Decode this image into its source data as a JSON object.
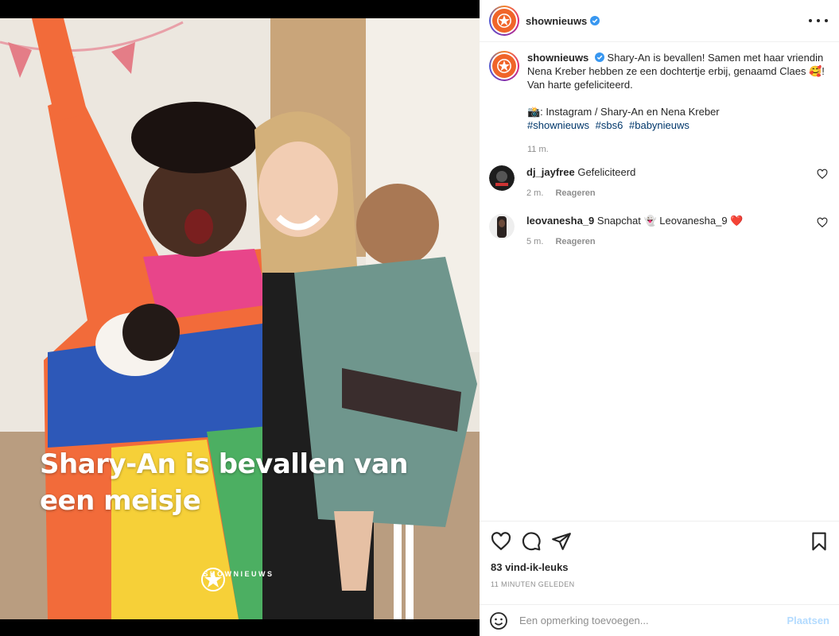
{
  "post": {
    "overlay_title_line1": "Shary-An is bevallen van",
    "overlay_title_line2": "een meisje",
    "watermark_label": "SHOWNIEUWS"
  },
  "header": {
    "username": "shownieuws",
    "verified": true
  },
  "caption": {
    "username": "shownieuws",
    "text": "Shary-An is bevallen! Samen met haar vriendin Nena Kreber hebben ze een dochtertje erbij, genaamd Claes 🥰! Van harte gefeliciteerd.",
    "credit": "📸: Instagram / Shary-An en Nena Kreber",
    "hashtags": [
      "#shownieuws",
      "#sbs6",
      "#babynieuws"
    ],
    "time": "11 m."
  },
  "comments": [
    {
      "username": "dj_jayfree",
      "text": "Gefeliciteerd",
      "time": "2 m.",
      "reply_label": "Reageren"
    },
    {
      "username": "leovanesha_9",
      "text": "Snapchat 👻 Leovanesha_9 ❤️",
      "time": "5 m.",
      "reply_label": "Reageren"
    }
  ],
  "stats": {
    "likes": "83 vind-ik-leuks",
    "posted": "11 MINUTEN GELEDEN"
  },
  "add_comment": {
    "placeholder": "Een opmerking toevoegen...",
    "post_label": "Plaatsen"
  },
  "colors": {
    "brand_orange": "#f0652a",
    "link_blue": "#00376b",
    "verified_blue": "#3897f0",
    "post_button_disabled": "#b3dbff"
  },
  "icons": [
    "heart-icon",
    "comment-icon",
    "share-icon",
    "bookmark-icon",
    "emoji-icon",
    "more-icon",
    "verified-icon",
    "star-logo-icon"
  ]
}
